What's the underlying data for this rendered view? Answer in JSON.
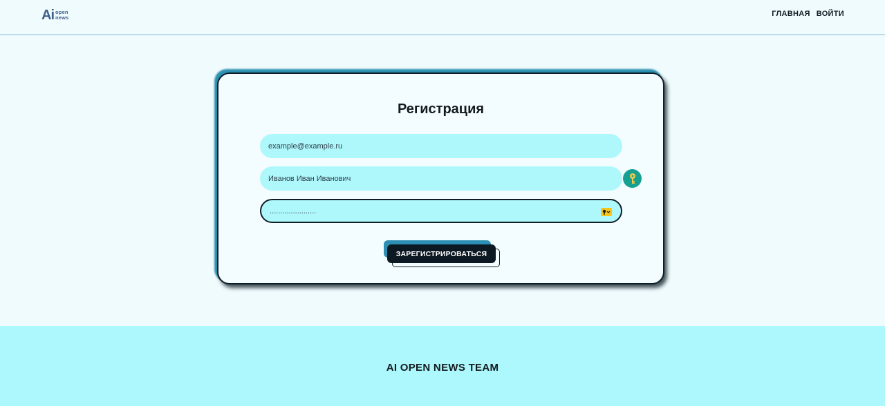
{
  "header": {
    "logo": {
      "mark": "Ai",
      "line1": "open",
      "line2": "news"
    },
    "nav": [
      {
        "label": "ГЛАВНАЯ"
      },
      {
        "label": "ВОЙТИ"
      }
    ]
  },
  "form": {
    "title": "Регистрация",
    "email": {
      "placeholder": "example@example.ru",
      "value": ""
    },
    "name": {
      "placeholder": "Иванов Иван Иванович",
      "value": ""
    },
    "password": {
      "value": "......................"
    },
    "icons": {
      "name_field_badge": "key-icon",
      "password_field_badge": "password-manager-icon"
    },
    "submit_label": "ЗАРЕГИСТРИРОВАТЬСЯ"
  },
  "footer": {
    "text": "AI OPEN NEWS TEAM"
  },
  "colors": {
    "background": "#f0fbfd",
    "input_fill": "#aef8fc",
    "accent_blue": "#2d8fb3",
    "dark": "#0c1822",
    "key_badge": "#16a091",
    "footer_bg": "#adf8fc"
  }
}
